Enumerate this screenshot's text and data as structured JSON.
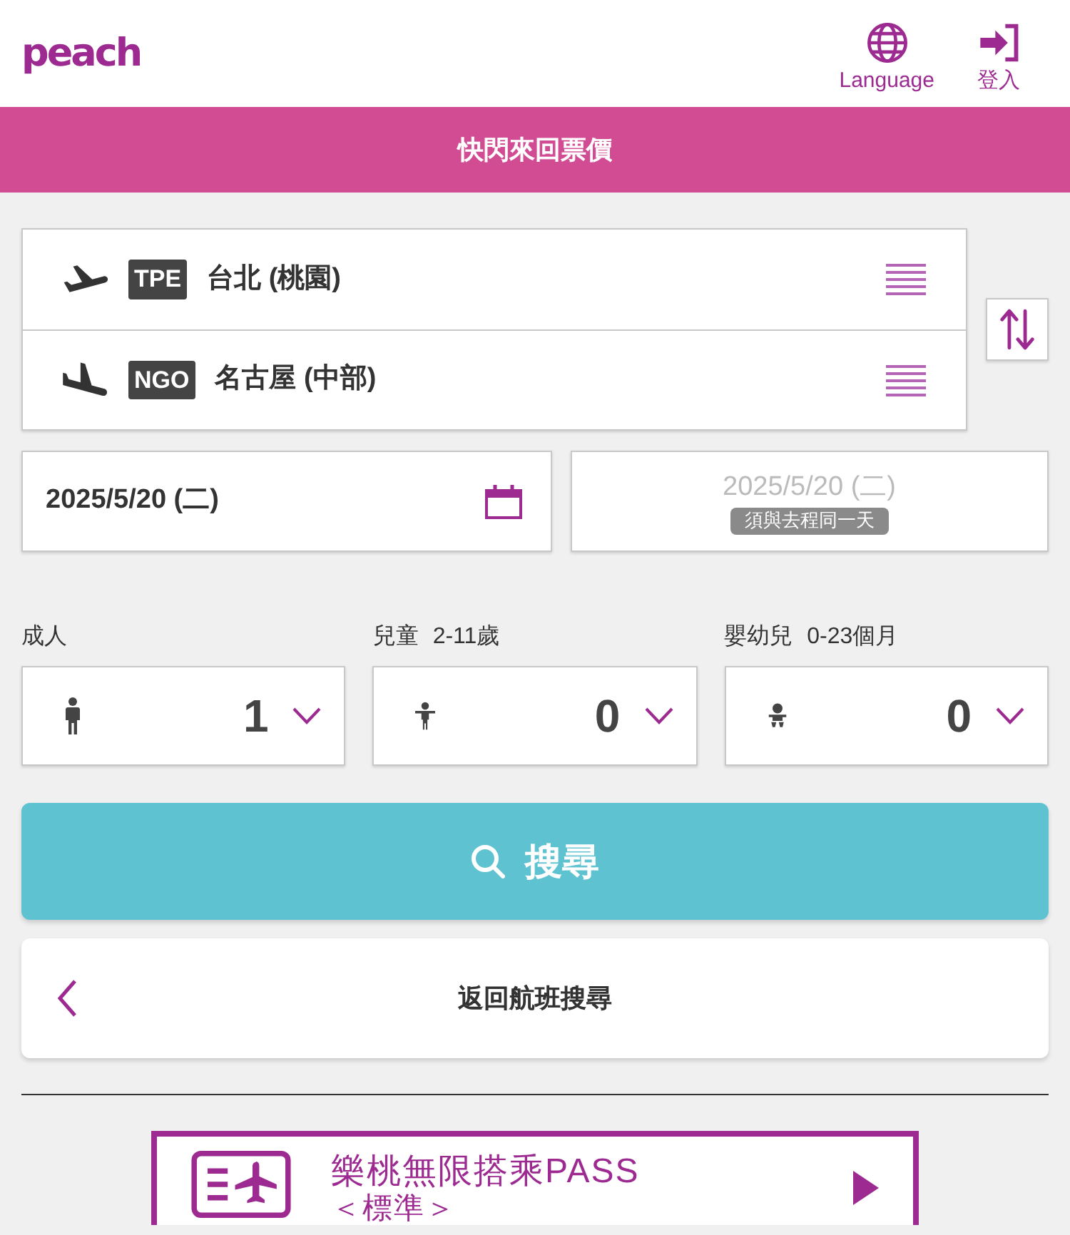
{
  "header": {
    "logo": "peach",
    "links": [
      {
        "kind": "language",
        "label": "Language"
      },
      {
        "kind": "login",
        "label": "登入"
      }
    ]
  },
  "banner": {
    "title": "快閃來回票價"
  },
  "route": {
    "legs": [
      {
        "kind": "departure",
        "code": "TPE",
        "city": "台北 (桃園)"
      },
      {
        "kind": "arrival",
        "code": "NGO",
        "city": "名古屋 (中部)"
      }
    ]
  },
  "dates": {
    "outbound": {
      "value": "2025/5/20 (二)"
    },
    "return": {
      "value": "2025/5/20 (二)",
      "note": "須與去程同一天",
      "disabled": true
    }
  },
  "passengers": [
    {
      "kind": "adult",
      "label": "成人",
      "value": "1"
    },
    {
      "kind": "child",
      "label": "兒童",
      "age_range": "2-11歲",
      "value": "0"
    },
    {
      "kind": "infant",
      "label": "嬰幼兒",
      "age_range": "0-23個月",
      "value": "0"
    }
  ],
  "search_button": {
    "label": "搜尋"
  },
  "back_button": {
    "label": "返回航班搜尋"
  },
  "promo": {
    "title": "樂桃無限搭乘PASS",
    "subtitle": "＜標準＞"
  }
}
